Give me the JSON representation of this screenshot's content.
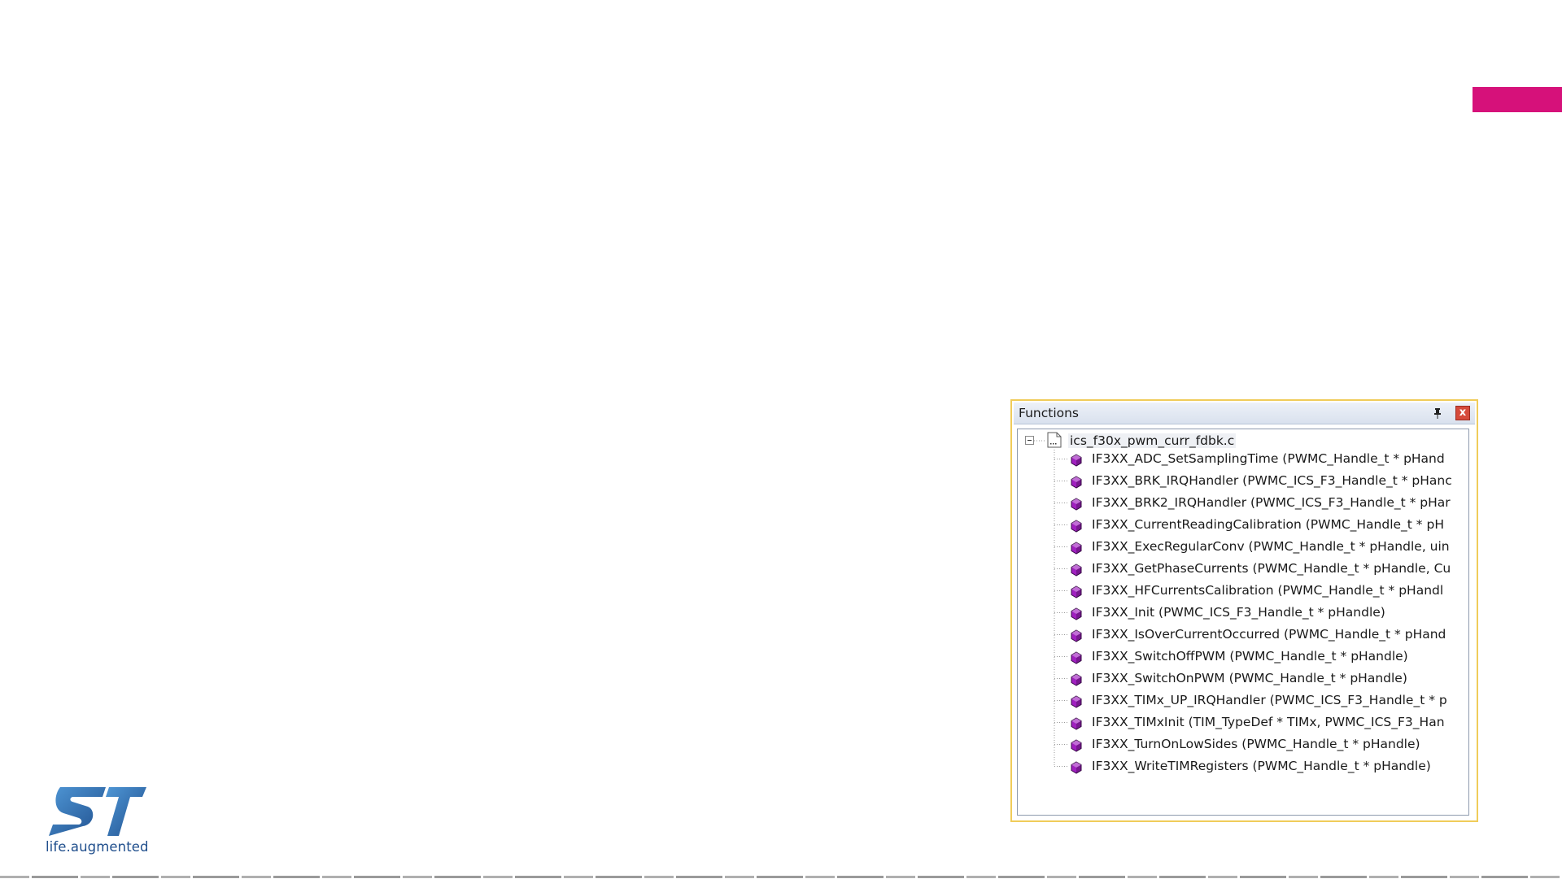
{
  "colors": {
    "accent": "#d6117a",
    "logo_blue": "#1f4e8c",
    "logo_light_blue": "#3b7fc4",
    "panel_border": "#f0cc5a",
    "function_icon": "#a020c0"
  },
  "brand": {
    "logo_icon": "st-logo-icon",
    "tagline": "life.augmented"
  },
  "panel": {
    "title": "Functions",
    "pin_icon": "pin-icon",
    "close_icon": "close-icon",
    "close_label": "x",
    "file": {
      "name": "ics_f30x_pwm_curr_fdbk.c",
      "icon": "source-file-icon",
      "expanded": true
    },
    "functions": [
      "IF3XX_ADC_SetSamplingTime (PWMC_Handle_t * pHand",
      "IF3XX_BRK_IRQHandler (PWMC_ICS_F3_Handle_t * pHanc",
      "IF3XX_BRK2_IRQHandler (PWMC_ICS_F3_Handle_t * pHar",
      "IF3XX_CurrentReadingCalibration (PWMC_Handle_t * pH",
      "IF3XX_ExecRegularConv (PWMC_Handle_t * pHandle, uin",
      "IF3XX_GetPhaseCurrents (PWMC_Handle_t * pHandle, Cu",
      "IF3XX_HFCurrentsCalibration (PWMC_Handle_t * pHandl",
      "IF3XX_Init (PWMC_ICS_F3_Handle_t * pHandle)",
      "IF3XX_IsOverCurrentOccurred (PWMC_Handle_t * pHand",
      "IF3XX_SwitchOffPWM (PWMC_Handle_t * pHandle)",
      "IF3XX_SwitchOnPWM (PWMC_Handle_t * pHandle)",
      "IF3XX_TIMx_UP_IRQHandler (PWMC_ICS_F3_Handle_t * p",
      "IF3XX_TIMxInit (TIM_TypeDef * TIMx, PWMC_ICS_F3_Han",
      "IF3XX_TurnOnLowSides (PWMC_Handle_t * pHandle)",
      "IF3XX_WriteTIMRegisters (PWMC_Handle_t * pHandle)"
    ]
  }
}
